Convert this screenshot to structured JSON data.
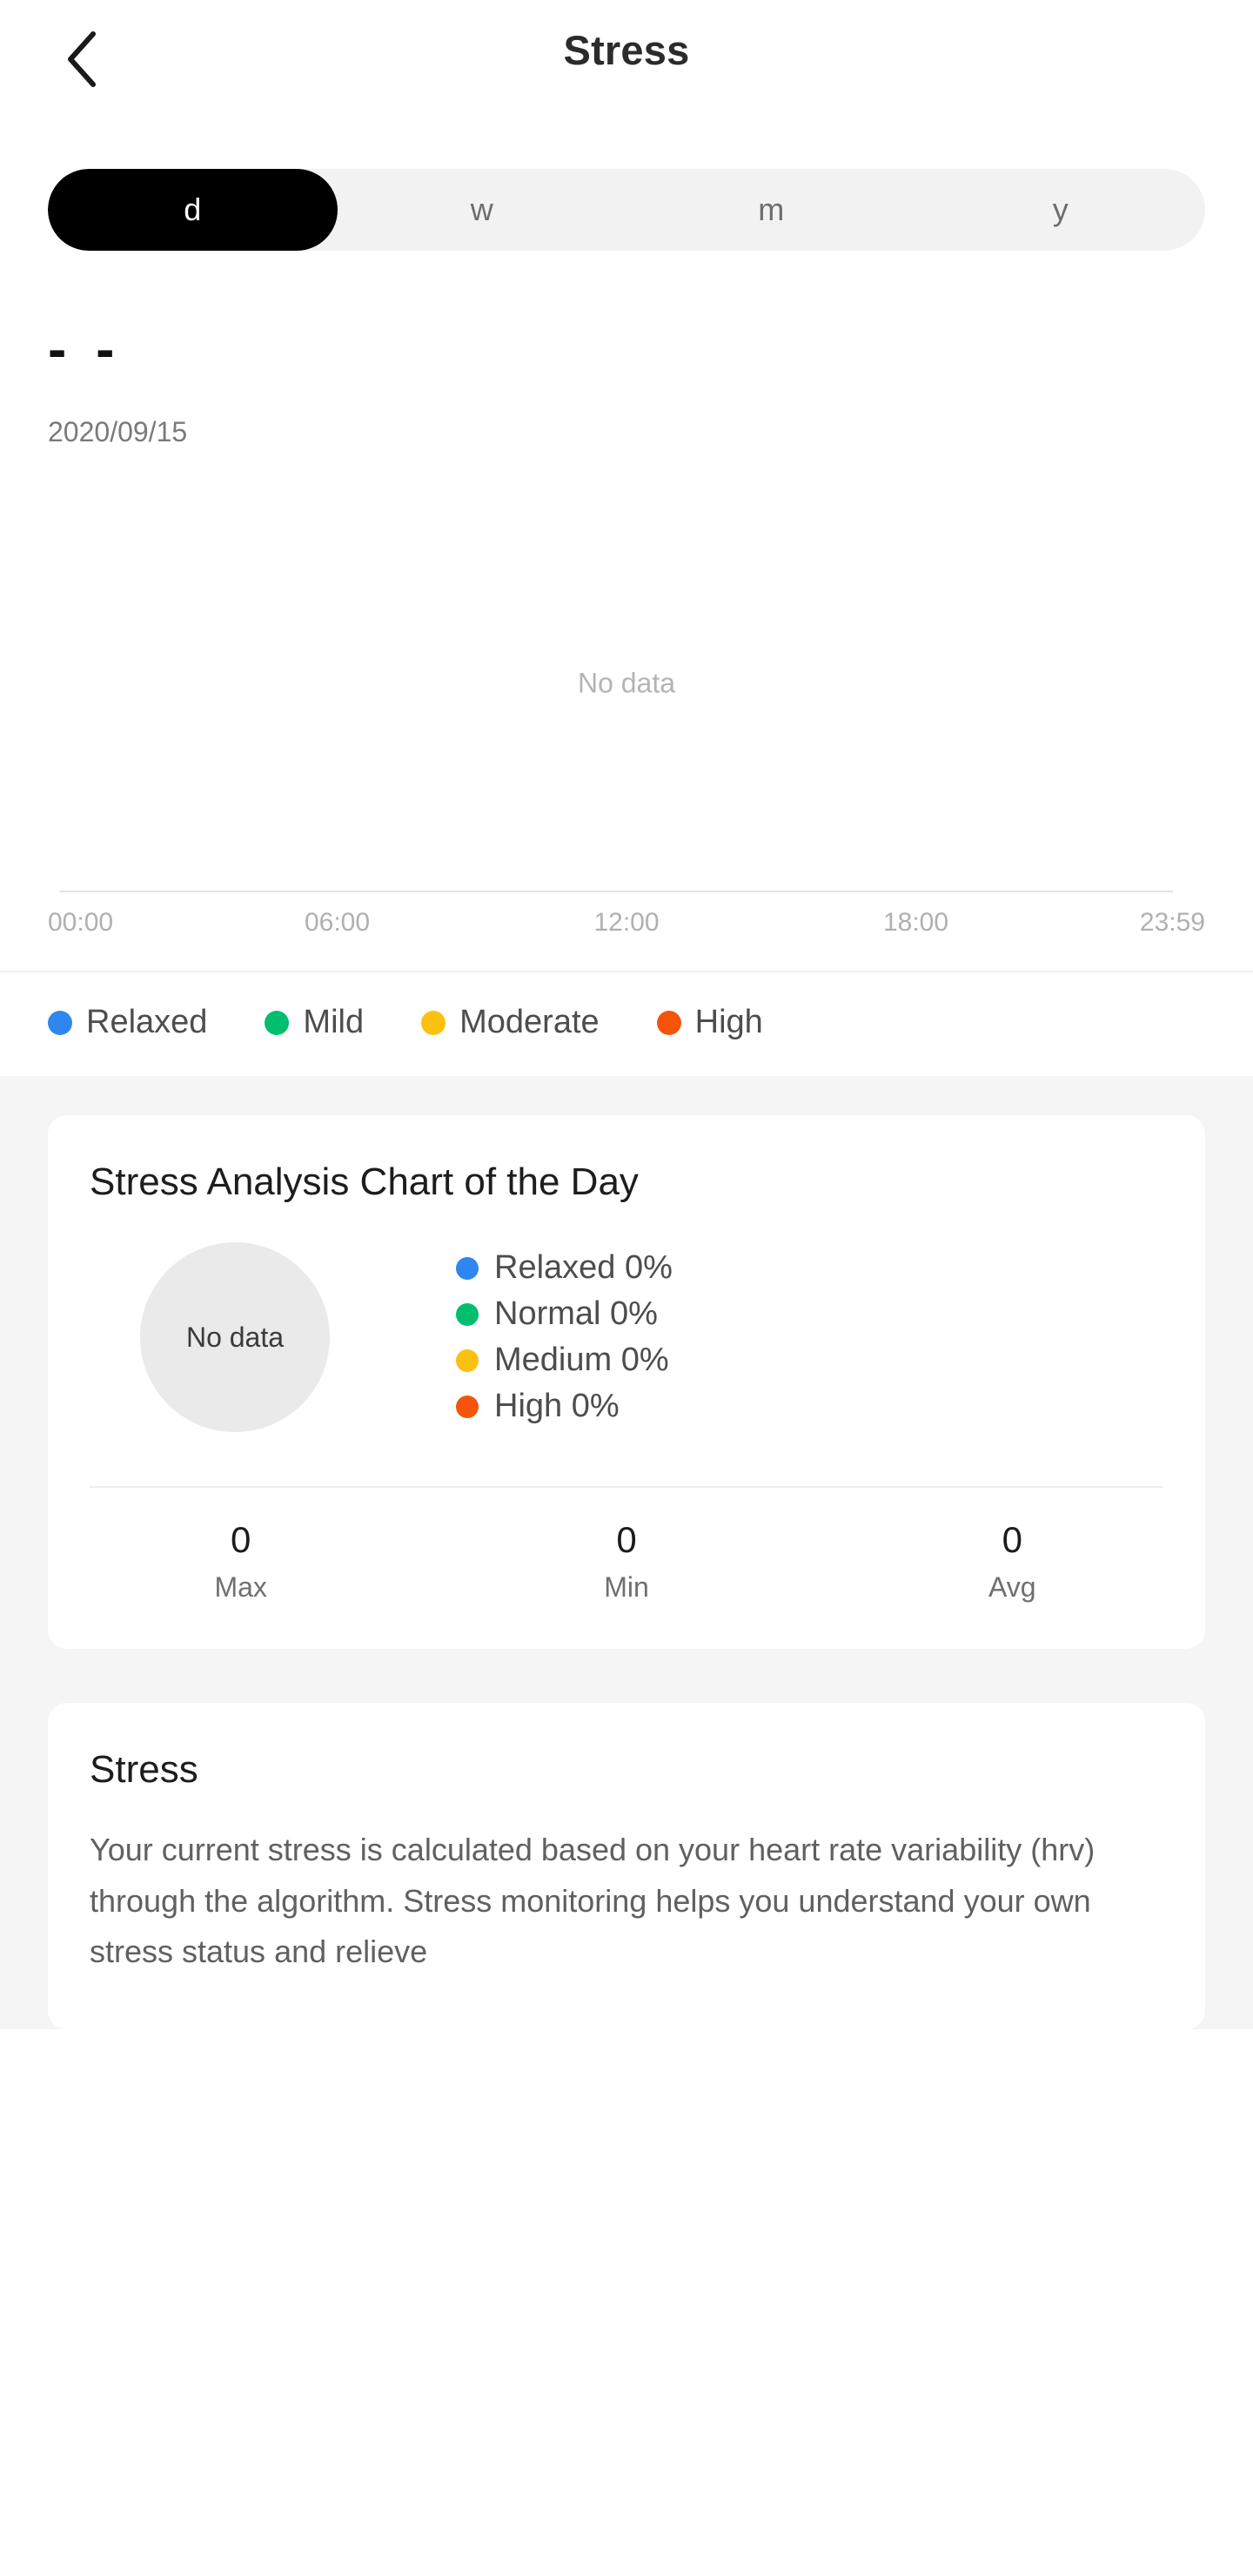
{
  "header": {
    "title": "Stress",
    "back_icon": "chevron-left-icon"
  },
  "tabs": {
    "items": [
      {
        "label": "d",
        "active": true
      },
      {
        "label": "w",
        "active": false
      },
      {
        "label": "m",
        "active": false
      },
      {
        "label": "y",
        "active": false
      }
    ]
  },
  "summary": {
    "value": "- -",
    "date": "2020/09/15"
  },
  "chart_data": {
    "type": "line",
    "title": "",
    "empty_text": "No data",
    "xlabel": "",
    "ylabel": "",
    "x_ticks": [
      "00:00",
      "06:00",
      "12:00",
      "18:00",
      "23:59"
    ],
    "x_tick_positions": [
      0,
      25,
      50,
      75,
      100
    ],
    "series": [
      {
        "name": "Relaxed",
        "color": "#2f86f0",
        "values": []
      },
      {
        "name": "Mild",
        "color": "#00be6e",
        "values": []
      },
      {
        "name": "Moderate",
        "color": "#fcc011",
        "values": []
      },
      {
        "name": "High",
        "color": "#f4550a",
        "values": []
      }
    ],
    "grid": false,
    "legend_position": "bottom"
  },
  "chart_legend": {
    "items": [
      {
        "label": "Relaxed",
        "color": "#2f86f0"
      },
      {
        "label": "Mild",
        "color": "#00be6e"
      },
      {
        "label": "Moderate",
        "color": "#fcc011"
      },
      {
        "label": "High",
        "color": "#f4550a"
      }
    ]
  },
  "analysis_card": {
    "title": "Stress Analysis Chart of the Day",
    "donut": {
      "empty_text": "No data",
      "fill_color": "#eaeaea"
    },
    "breakdown": [
      {
        "label": "Relaxed 0%",
        "color": "#2f86f0",
        "value": 0
      },
      {
        "label": "Normal 0%",
        "color": "#00be6e",
        "value": 0
      },
      {
        "label": "Medium 0%",
        "color": "#fcc011",
        "value": 0
      },
      {
        "label": "High 0%",
        "color": "#f4550a",
        "value": 0
      }
    ],
    "stats": [
      {
        "value": "0",
        "label": "Max"
      },
      {
        "value": "0",
        "label": "Min"
      },
      {
        "value": "0",
        "label": "Avg"
      }
    ]
  },
  "info_card": {
    "title": "Stress",
    "body": "Your current stress is calculated based on your heart rate variability (hrv) through the algorithm. Stress monitoring helps you understand your own stress status and relieve"
  }
}
